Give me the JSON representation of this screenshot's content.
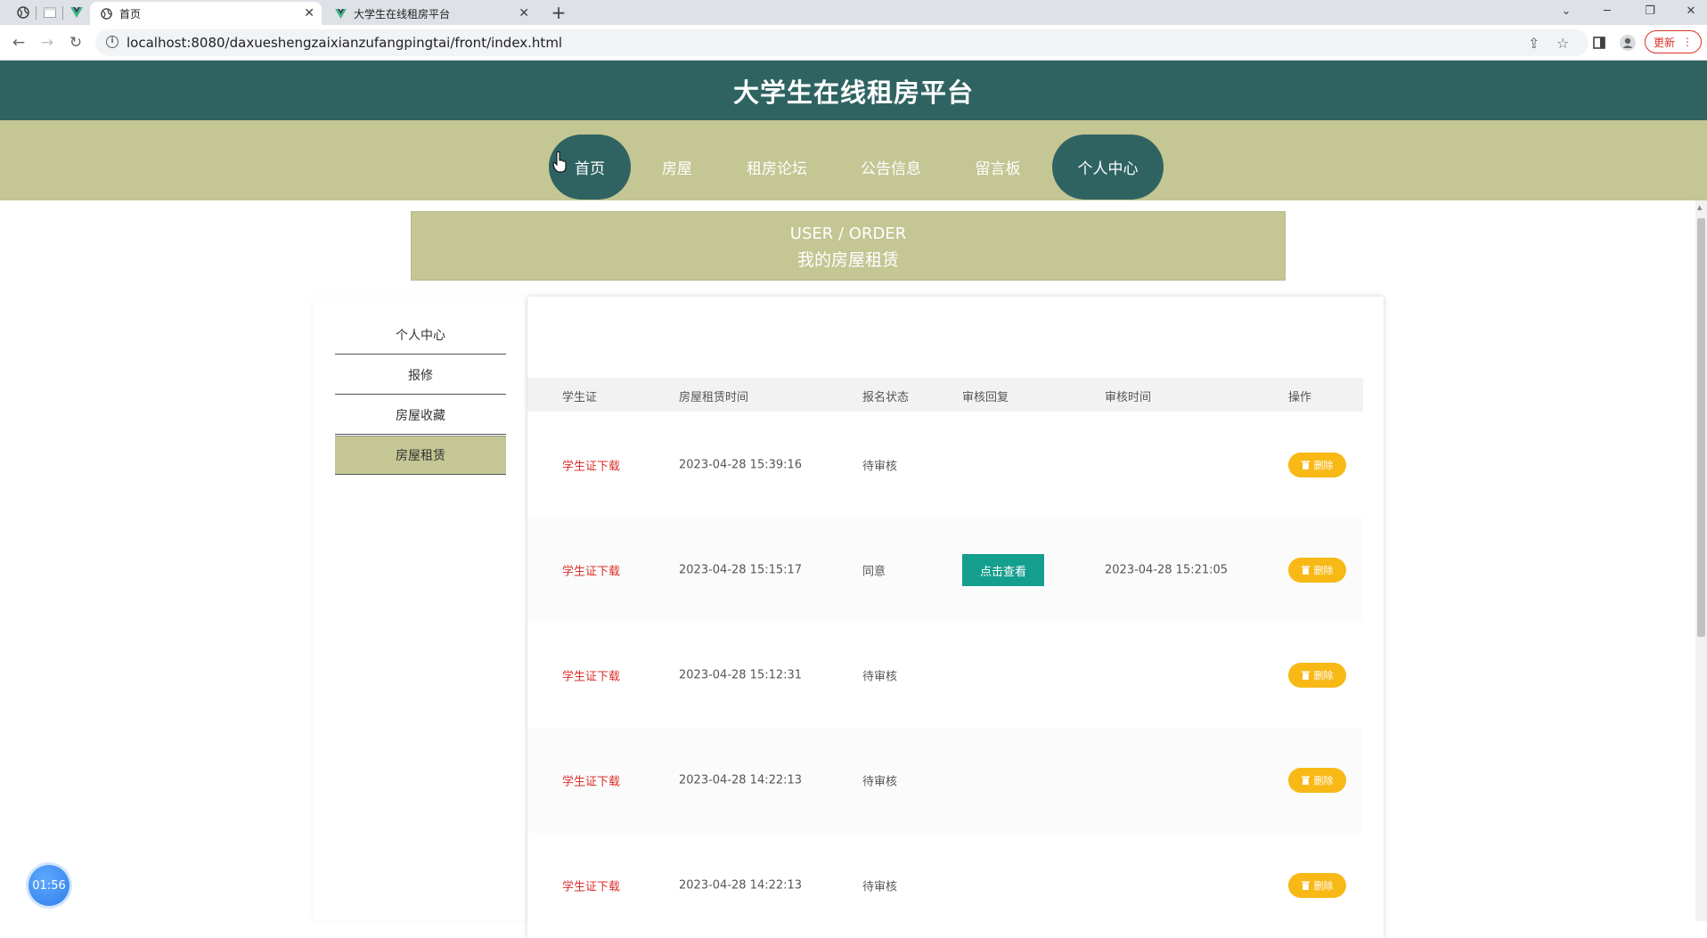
{
  "browser": {
    "tabs": [
      {
        "label": "首页",
        "active": true
      },
      {
        "label": "大学生在线租房平台",
        "active": false
      }
    ],
    "url": "localhost:8080/daxueshengzaixianzufangpingtai/front/index.html",
    "update_label": "更新"
  },
  "site": {
    "title": "大学生在线租房平台",
    "nav": [
      {
        "label": "首页"
      },
      {
        "label": "房屋"
      },
      {
        "label": "租房论坛"
      },
      {
        "label": "公告信息"
      },
      {
        "label": "留言板"
      },
      {
        "label": "个人中心"
      }
    ]
  },
  "banner": {
    "en": "USER / ORDER",
    "zh": "我的房屋租赁"
  },
  "sidebar": {
    "items": [
      {
        "label": "个人中心",
        "active": false
      },
      {
        "label": "报修",
        "active": false
      },
      {
        "label": "房屋收藏",
        "active": false
      },
      {
        "label": "房屋租赁",
        "active": true
      }
    ]
  },
  "table": {
    "headers": [
      "学生证",
      "房屋租赁时间",
      "报名状态",
      "审核回复",
      "审核时间",
      "操作"
    ],
    "rows": [
      {
        "student_card": "学生证下载",
        "time": "2023-04-28 15:39:16",
        "status": "待审核",
        "reply": "",
        "review_time": "",
        "action": "删除"
      },
      {
        "student_card": "学生证下载",
        "time": "2023-04-28 15:15:17",
        "status": "同意",
        "reply": "点击查看",
        "review_time": "2023-04-28 15:21:05",
        "action": "删除"
      },
      {
        "student_card": "学生证下载",
        "time": "2023-04-28 15:12:31",
        "status": "待审核",
        "reply": "",
        "review_time": "",
        "action": "删除"
      },
      {
        "student_card": "学生证下载",
        "time": "2023-04-28 14:22:13",
        "status": "待审核",
        "reply": "",
        "review_time": "",
        "action": "删除"
      },
      {
        "student_card": "学生证下载",
        "time": "2023-04-28 14:22:13",
        "status": "待审核",
        "reply": "",
        "review_time": "",
        "action": "删除"
      }
    ]
  },
  "timer": {
    "label": "01:56"
  },
  "colors": {
    "header": "#2f6361",
    "nav": "#c4c694",
    "link": "#d9302c",
    "view_button": "#149e8e",
    "delete_button": "#f8b917"
  }
}
